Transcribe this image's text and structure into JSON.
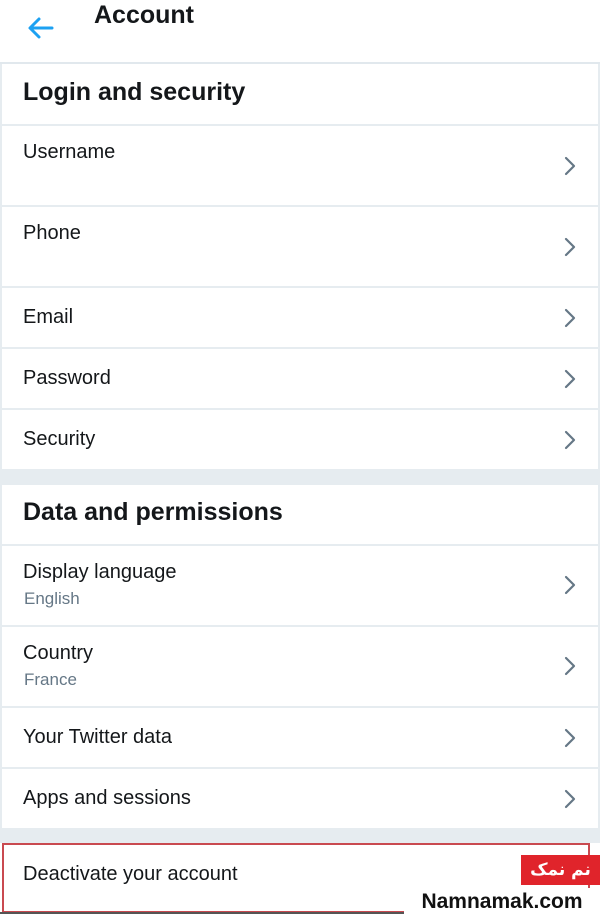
{
  "header": {
    "title": "Account",
    "back_icon": "arrow-left-icon",
    "accent": "#1da1f2"
  },
  "sections": {
    "login": {
      "title": "Login and security",
      "items": [
        {
          "label": "Username",
          "sub": ""
        },
        {
          "label": "Phone",
          "sub": ""
        },
        {
          "label": "Email"
        },
        {
          "label": "Password"
        },
        {
          "label": "Security"
        }
      ]
    },
    "data": {
      "title": "Data and permissions",
      "items": [
        {
          "label": "Display language",
          "sub": "English"
        },
        {
          "label": "Country",
          "sub": "France"
        },
        {
          "label": "Your Twitter data"
        },
        {
          "label": "Apps and sessions"
        }
      ]
    }
  },
  "deactivate": {
    "label": "Deactivate your account",
    "highlight_color": "#c94a50"
  },
  "watermark": {
    "persian": "نم نمک",
    "site": "Namnamak.com",
    "badge_color": "#e0242b"
  },
  "icons": {
    "row_chevron": "chevron-right-icon"
  }
}
